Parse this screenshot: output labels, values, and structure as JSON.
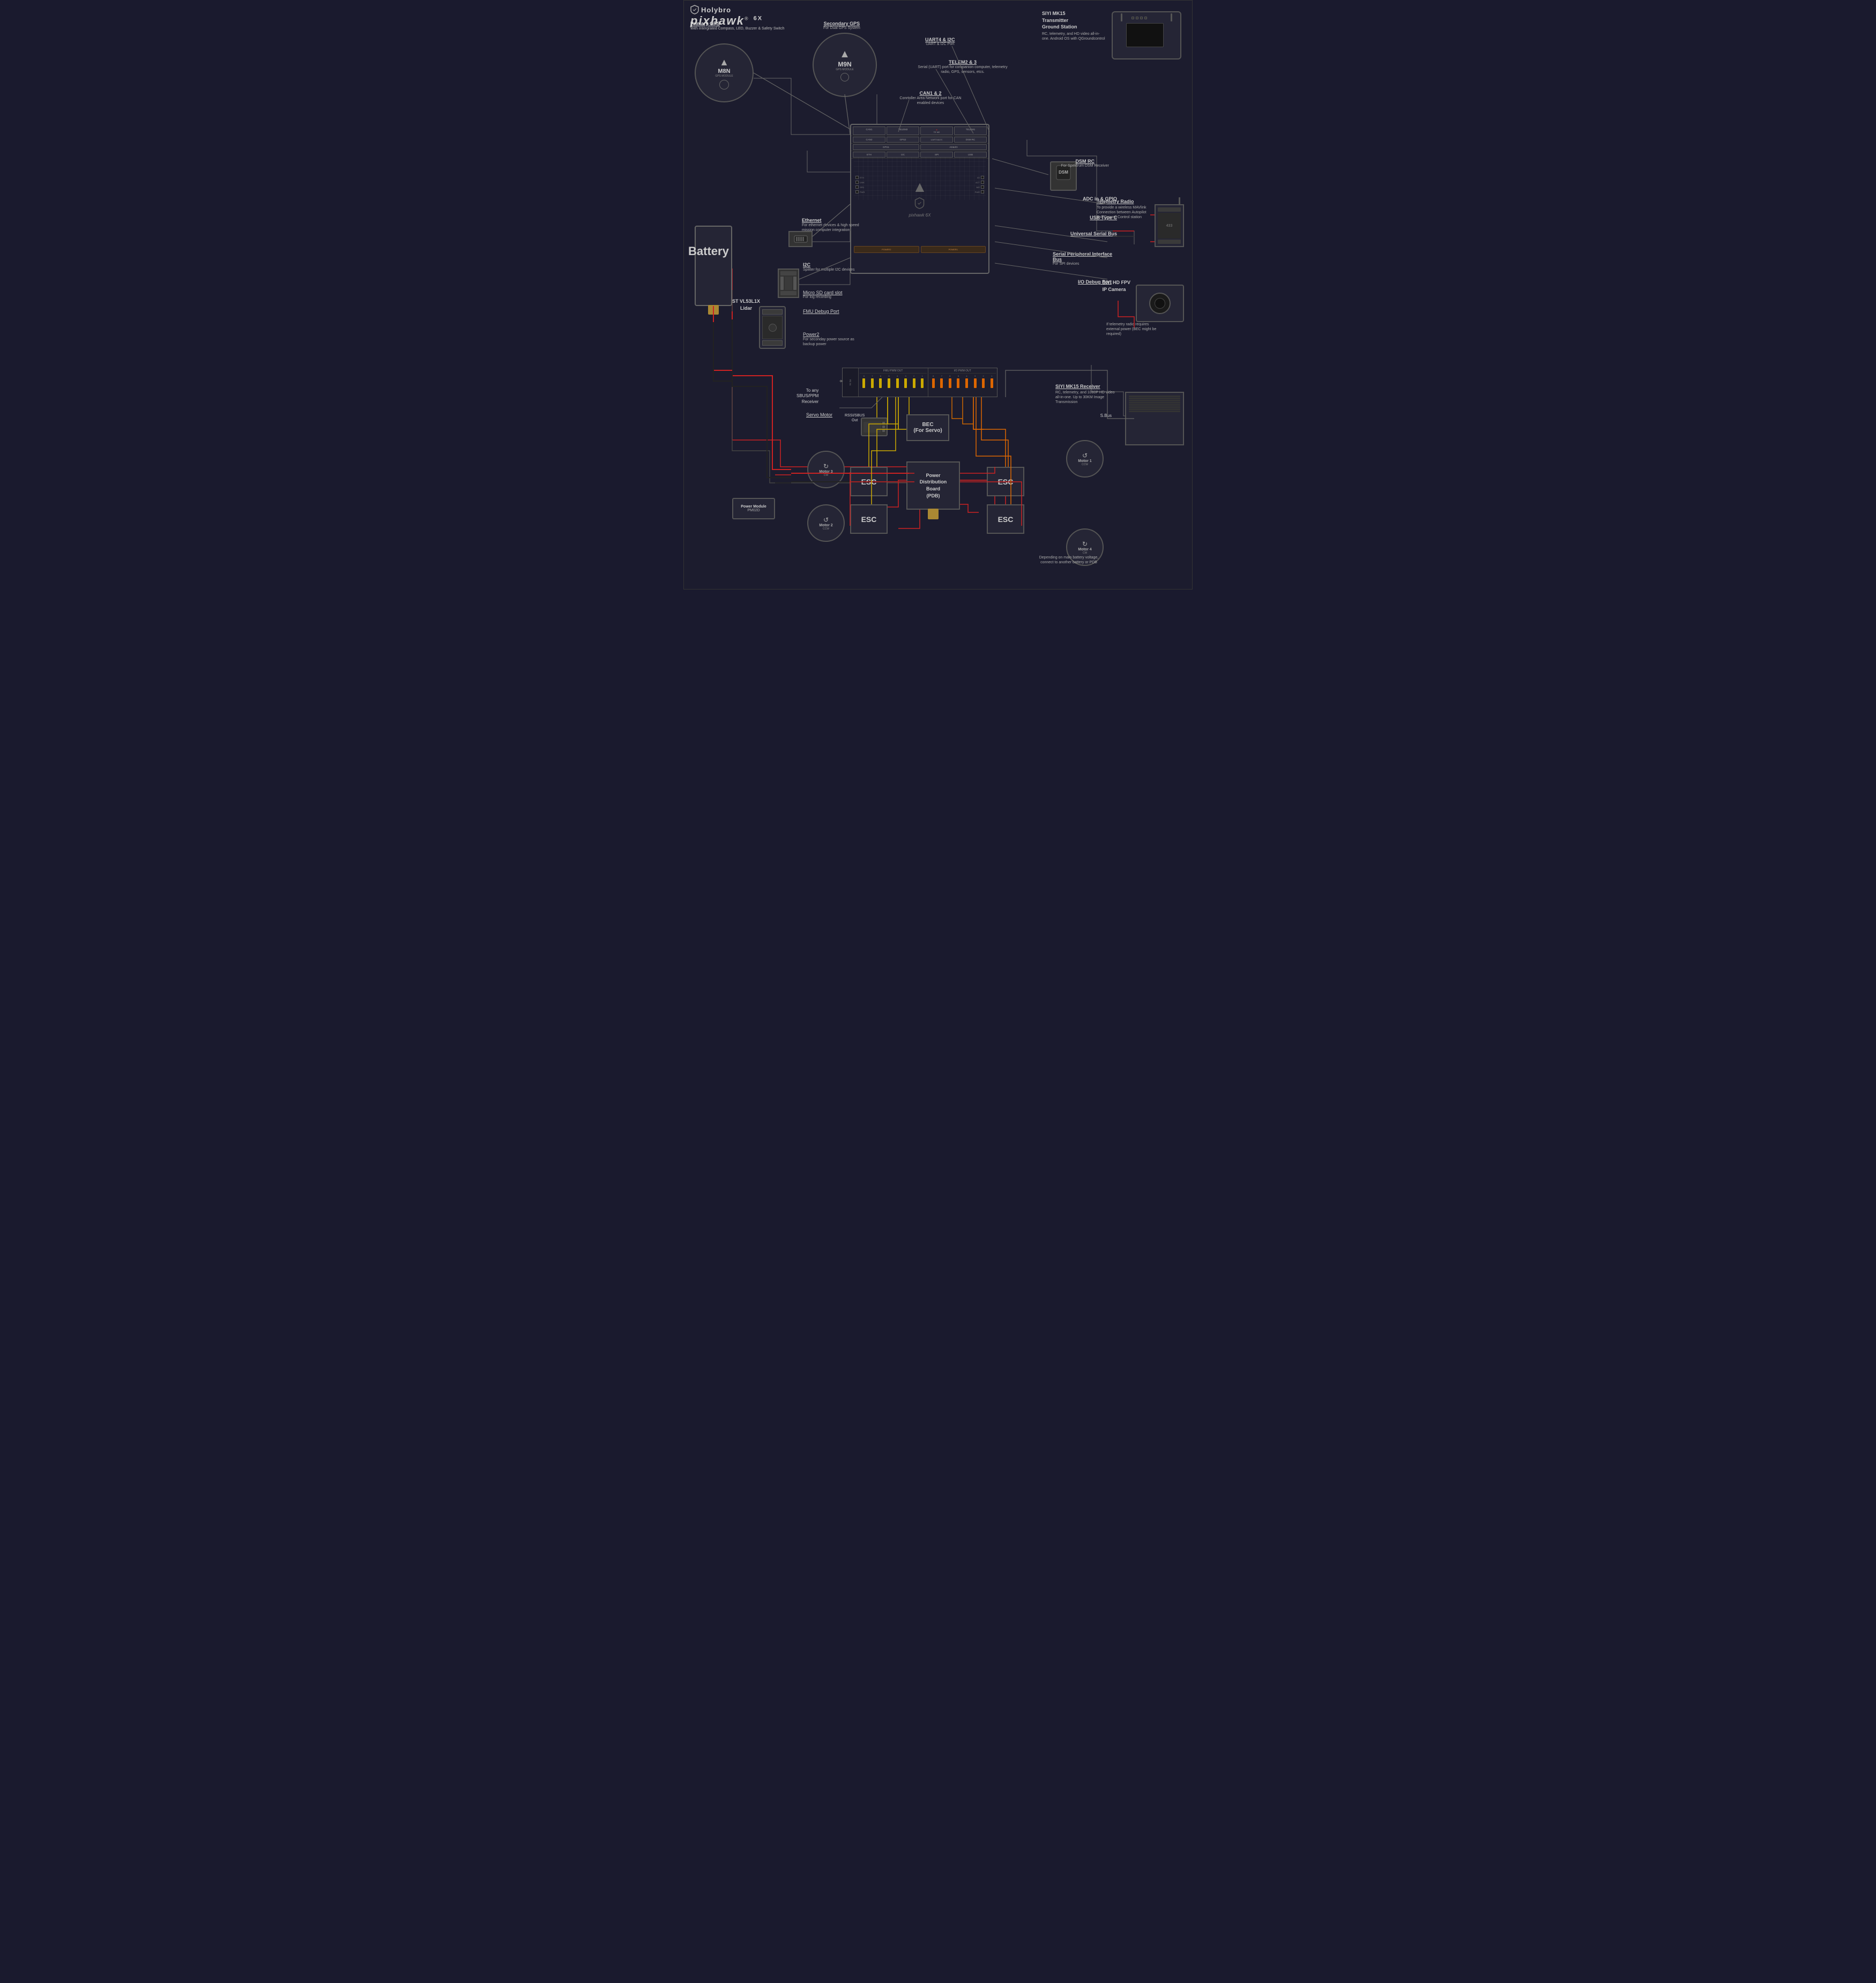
{
  "header": {
    "brand": "Holybro",
    "product": "pixhawk",
    "product_suffix": "®",
    "model": "6X"
  },
  "components": {
    "primary_gps": {
      "title": "Primary GPS",
      "description": "With Intergrated Compass, LED, Buzzer & Safety Switch",
      "model": "M8N",
      "subtitle": "GPS MODULE"
    },
    "secondary_gps": {
      "title": "Secondary GPS",
      "description": "For Dual GPS System",
      "model": "M9N",
      "subtitle": "GPS MODULE"
    },
    "battery": {
      "label": "Battery"
    },
    "power_module": {
      "label": "Power Module",
      "model": "PM02D"
    },
    "ethernet": {
      "title": "Ethernet",
      "description": "For ethernet devices & high speed mission computer integration"
    },
    "i2c": {
      "title": "I2C",
      "description": "Splitter for multiple I2C devices"
    },
    "micro_sd": {
      "title": "Micro SD card slot",
      "description": "For log recording"
    },
    "fmu_debug": {
      "title": "FMU Debug Port"
    },
    "power2": {
      "title": "Power2",
      "description": "For seconday power source as backup power"
    },
    "lidar": {
      "title": "ST VL53L1X\nLidar"
    },
    "dsm_rc": {
      "title": "DSM RC",
      "description": "For Spektrum DSM Receiver"
    },
    "adc_gpio": {
      "title": "ADC in & GPIO"
    },
    "usb_type_c": {
      "title": "USB Type C"
    },
    "universal_serial": {
      "title": "Universal Serial Bus"
    },
    "spi_bus": {
      "title": "Serial Peripheral Interface Bus",
      "description": "For SPI devices"
    },
    "io_debug": {
      "title": "I/O Debug Port"
    },
    "uart4_i2c": {
      "title": "UART4 & I2C",
      "description": "UART & I2C Port"
    },
    "telem2_3": {
      "title": "TELEM2 & 3",
      "description": "Serial (UART) port for companion computer, telemetry radio, GPS, sensors, etcs."
    },
    "can1_2": {
      "title": "CAN1 & 2",
      "description": "Conrtoller Area Network port for CAN enabled devices"
    },
    "sbus_ppm": {
      "title": "To any\nSBUS/PPM\nReceiver"
    },
    "rssi_sbus": {
      "title": "RSSI/SBUS\nOut"
    },
    "servo_motor": {
      "title": "Servo Motor"
    },
    "bec": {
      "title": "BEC\n(For Servo)"
    },
    "pdb": {
      "title": "Power\nDistribution\nBoard\n(PDB)"
    },
    "motor1": {
      "label": "Motor 1",
      "dir": "CCW"
    },
    "motor2": {
      "label": "Motor 2",
      "dir": "CCW"
    },
    "motor3": {
      "label": "Motor 3",
      "dir": "CW"
    },
    "motor4": {
      "label": "Motor 4",
      "dir": "CW"
    },
    "esc1": {
      "label": "ESC"
    },
    "esc2": {
      "label": "ESC"
    },
    "esc3": {
      "label": "ESC"
    },
    "esc4": {
      "label": "ESC"
    },
    "transmitter": {
      "title": "SIYI MK15\nTransmitter\nGround Station",
      "description": "RC, telemetry, and HD video all-in-one. Android OS with QGroundcontrol"
    },
    "telemetry_radio": {
      "title": "Telemetry Radio",
      "description": "To provide a wireless MAVlink Connection between Autopilot and Ground Control station"
    },
    "fpv_camera": {
      "title": "SIYI HD FPV\nIP Camera"
    },
    "mk15_receiver": {
      "title": "SIYI MK15 Receiver",
      "description": "RC, telemetry, and 1080P HD video all-in-one. Up to 30KM Image Transmission"
    },
    "bec_note": {
      "text": "If telemetry radio requires external power (BEC might be required)"
    },
    "battery_note": {
      "text": "Depending on main battery voltage, connect to another battery or PDB"
    },
    "s_bus_label": {
      "text": "S.Bus"
    },
    "fmu_pwm_label": {
      "text": "FMU PWM OUT"
    },
    "io_pwm_label": {
      "text": "I/O PWM OUT"
    },
    "pwm_numbers_fmu": {
      "text": "8 7 6 5 4 3 2 1"
    },
    "pwm_numbers_io": {
      "text": "8 7 6 5 4 3 2 1"
    }
  },
  "ports": {
    "top_row": [
      "CAN1",
      "TELEM3",
      "TELEM2",
      "TELEM1"
    ],
    "second_row": [
      "CAN2",
      "GPS2",
      "UART4&I2C",
      "DSM RC"
    ],
    "third_row": [
      "GPS1",
      "AD&I/O"
    ],
    "fourth_row": [
      "ETH",
      "I2C",
      "SPI",
      "USB"
    ]
  },
  "colors": {
    "background": "#1c1c2e",
    "board_bg": "#1e1e30",
    "component_bg": "#252535",
    "text_primary": "#cccccc",
    "text_dim": "#888888",
    "wire_red": "#cc2222",
    "wire_yellow": "#ccaa00",
    "wire_orange": "#dd6600",
    "wire_gray": "#666666"
  }
}
